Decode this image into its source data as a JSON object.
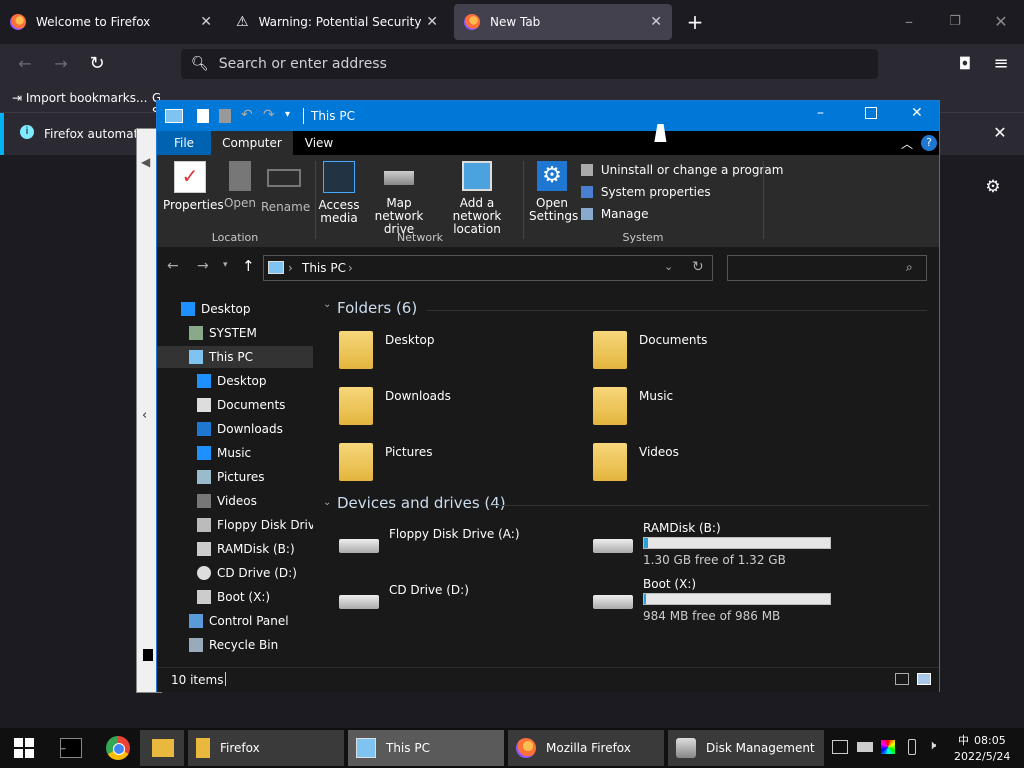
{
  "firefox": {
    "tabs": [
      {
        "label": "Welcome to Firefox"
      },
      {
        "label": "Warning: Potential Security Risk"
      },
      {
        "label": "New Tab"
      }
    ],
    "urlbar_placeholder": "Search or enter address",
    "bookmarks": [
      {
        "label": "Import bookmarks..."
      },
      {
        "label": "Getting Started"
      }
    ],
    "info_bar_text": "Firefox automatic"
  },
  "explorer": {
    "title": "This PC",
    "ribbon_tabs": [
      "File",
      "Computer",
      "View"
    ],
    "ribbon": {
      "location": {
        "label": "Location",
        "buttons": [
          "Properties",
          "Open",
          "Rename"
        ]
      },
      "network": {
        "label": "Network",
        "buttons": [
          "Access media",
          "Map network drive",
          "Add a network location"
        ]
      },
      "system": {
        "label": "System",
        "open_settings": "Open Settings",
        "items": [
          "Uninstall or change a program",
          "System properties",
          "Manage"
        ]
      }
    },
    "address": {
      "path": "This PC"
    },
    "nav": [
      {
        "label": "Desktop",
        "icon": "desktop-icon"
      },
      {
        "label": "SYSTEM",
        "icon": "user-icon"
      },
      {
        "label": "This PC",
        "icon": "computer-icon"
      },
      {
        "label": "Desktop",
        "icon": "desktop-icon"
      },
      {
        "label": "Documents",
        "icon": "documents-icon"
      },
      {
        "label": "Downloads",
        "icon": "downloads-icon"
      },
      {
        "label": "Music",
        "icon": "music-icon"
      },
      {
        "label": "Pictures",
        "icon": "pictures-icon"
      },
      {
        "label": "Videos",
        "icon": "videos-icon"
      },
      {
        "label": "Floppy Disk Drive",
        "icon": "floppy-icon"
      },
      {
        "label": "RAMDisk (B:)",
        "icon": "drive-icon"
      },
      {
        "label": "CD Drive (D:)",
        "icon": "cd-icon"
      },
      {
        "label": "Boot (X:)",
        "icon": "drive-icon"
      },
      {
        "label": "Control Panel",
        "icon": "control-panel-icon"
      },
      {
        "label": "Recycle Bin",
        "icon": "recycle-bin-icon"
      }
    ],
    "folders_header": "Folders (6)",
    "folders": [
      {
        "label": "Desktop"
      },
      {
        "label": "Documents"
      },
      {
        "label": "Downloads"
      },
      {
        "label": "Music"
      },
      {
        "label": "Pictures"
      },
      {
        "label": "Videos"
      }
    ],
    "devices_header": "Devices and drives (4)",
    "devices": [
      {
        "label": "Floppy Disk Drive (A:)"
      },
      {
        "label": "RAMDisk (B:)",
        "free": "1.30 GB free of 1.32 GB",
        "used_fraction": 0.02
      },
      {
        "label": "CD Drive (D:)"
      },
      {
        "label": "Boot (X:)",
        "free": "984 MB free of 986 MB",
        "used_fraction": 0.002
      }
    ],
    "status": "10 items"
  },
  "taskbar": {
    "items": [
      {
        "label": "Firefox"
      },
      {
        "label": "This PC"
      },
      {
        "label": "Mozilla Firefox"
      },
      {
        "label": "Disk Management"
      }
    ],
    "ime": "中",
    "time": "08:05",
    "date": "2022/5/24"
  },
  "colors": {
    "accent": "#0078d7",
    "folder": "#e4b53e",
    "taskbar": "#101010"
  }
}
